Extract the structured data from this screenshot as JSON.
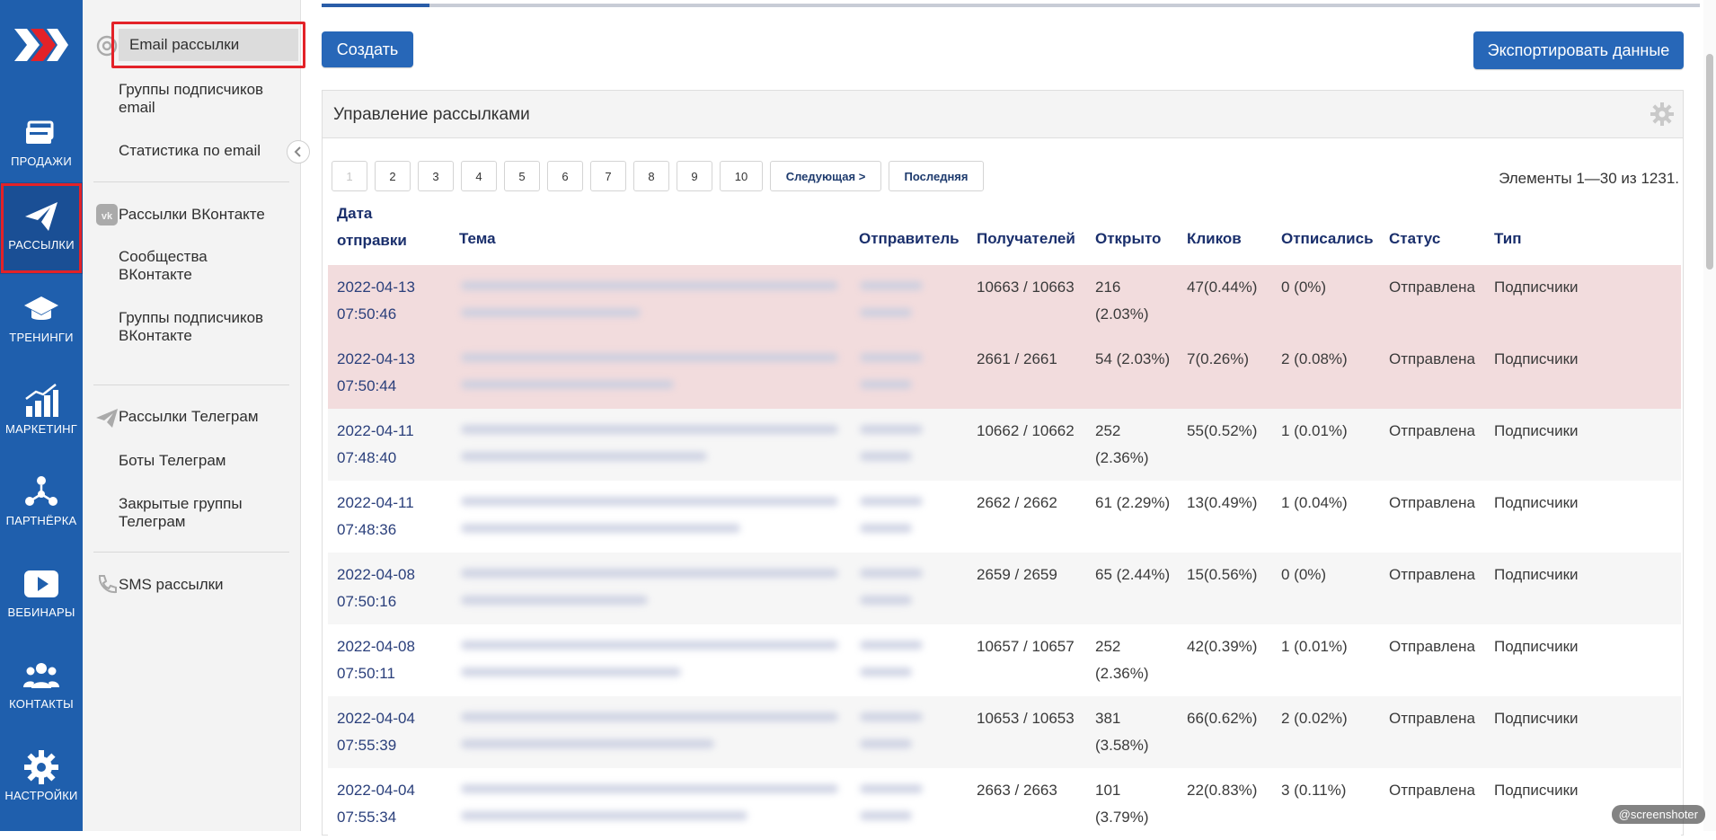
{
  "rail": {
    "items": [
      {
        "label": "ПРОДАЖИ",
        "icon": "cash-icon"
      },
      {
        "label": "РАССЫЛКИ",
        "icon": "paper-plane-icon",
        "active": true
      },
      {
        "label": "ТРЕНИНГИ",
        "icon": "graduation-cap-icon"
      },
      {
        "label": "МАРКЕТИНГ",
        "icon": "growth-chart-icon"
      },
      {
        "label": "ПАРТНЁРКА",
        "icon": "partner-network-icon"
      },
      {
        "label": "ВЕБИНАРЫ",
        "icon": "play-icon"
      },
      {
        "label": "КОНТАКТЫ",
        "icon": "people-icon"
      },
      {
        "label": "НАСТРОЙКИ",
        "icon": "gear-icon"
      }
    ]
  },
  "submenu": {
    "email": {
      "icon": "at-sign-icon",
      "items": [
        "Email рассылки",
        "Группы подписчиков email",
        "Статистика по email"
      ]
    },
    "vk": {
      "icon": "vk-icon",
      "items": [
        "Рассылки ВКонтакте",
        "Сообщества ВКонтакте",
        "Группы подписчиков ВКонтакте"
      ]
    },
    "telegram": {
      "icon": "telegram-icon",
      "items": [
        "Рассылки Телеграм",
        "Боты Телеграм",
        "Закрытые группы Телеграм"
      ]
    },
    "sms": {
      "icon": "phone-icon",
      "items": [
        "SMS рассылки"
      ]
    }
  },
  "toolbar": {
    "create_label": "Создать",
    "export_label": "Экспортировать данные"
  },
  "panel": {
    "title": "Управление рассылками",
    "settings_icon": "gear-icon"
  },
  "pagination": {
    "pages": [
      "1",
      "2",
      "3",
      "4",
      "5",
      "6",
      "7",
      "8",
      "9",
      "10"
    ],
    "current": "1",
    "next_label": "Следующая >",
    "last_label": "Последняя",
    "items_text": "Элементы 1—30 из 1231."
  },
  "table": {
    "headers": {
      "date_line1": "Дата",
      "date_line2": "отправки",
      "subject": "Тема",
      "sender": "Отправитель",
      "recipients": "Получателей",
      "opened": "Открыто",
      "clicks": "Кликов",
      "unsubscribed": "Отписались",
      "status": "Статус",
      "type": "Тип"
    },
    "rows": [
      {
        "date": "2022-04-13",
        "time": "07:50:46",
        "recipients": "10663 / 10663",
        "opened1": "216",
        "opened2": "(2.03%)",
        "clicks": "47(0.44%)",
        "unsub": "0 (0%)",
        "status": "Отправлена",
        "type": "Подписчики",
        "highlight": true
      },
      {
        "date": "2022-04-13",
        "time": "07:50:44",
        "recipients": "2661 / 2661",
        "opened1": "54 (2.03%)",
        "opened2": "",
        "clicks": "7(0.26%)",
        "unsub": "2 (0.08%)",
        "status": "Отправлена",
        "type": "Подписчики",
        "highlight": true
      },
      {
        "date": "2022-04-11",
        "time": "07:48:40",
        "recipients": "10662 / 10662",
        "opened1": "252",
        "opened2": "(2.36%)",
        "clicks": "55(0.52%)",
        "unsub": "1 (0.01%)",
        "status": "Отправлена",
        "type": "Подписчики"
      },
      {
        "date": "2022-04-11",
        "time": "07:48:36",
        "recipients": "2662 / 2662",
        "opened1": "61 (2.29%)",
        "opened2": "",
        "clicks": "13(0.49%)",
        "unsub": "1 (0.04%)",
        "status": "Отправлена",
        "type": "Подписчики"
      },
      {
        "date": "2022-04-08",
        "time": "07:50:16",
        "recipients": "2659 / 2659",
        "opened1": "65 (2.44%)",
        "opened2": "",
        "clicks": "15(0.56%)",
        "unsub": "0 (0%)",
        "status": "Отправлена",
        "type": "Подписчики"
      },
      {
        "date": "2022-04-08",
        "time": "07:50:11",
        "recipients": "10657 / 10657",
        "opened1": "252",
        "opened2": "(2.36%)",
        "clicks": "42(0.39%)",
        "unsub": "1 (0.01%)",
        "status": "Отправлена",
        "type": "Подписчики"
      },
      {
        "date": "2022-04-04",
        "time": "07:55:39",
        "recipients": "10653 / 10653",
        "opened1": "381",
        "opened2": "(3.58%)",
        "clicks": "66(0.62%)",
        "unsub": "2 (0.02%)",
        "status": "Отправлена",
        "type": "Подписчики"
      },
      {
        "date": "2022-04-04",
        "time": "07:55:34",
        "recipients": "2663 / 2663",
        "opened1": "101",
        "opened2": "(3.79%)",
        "clicks": "22(0.83%)",
        "unsub": "3 (0.11%)",
        "status": "Отправлена",
        "type": "Подписчики"
      }
    ]
  },
  "colors": {
    "rail_bg": "#1f5fad",
    "accent_blue": "#2767b8",
    "highlight_row": "#f2dcdd",
    "alt_row": "#f6f6f6",
    "annotation_red": "#e32228"
  },
  "watermark": "@screenshoter"
}
